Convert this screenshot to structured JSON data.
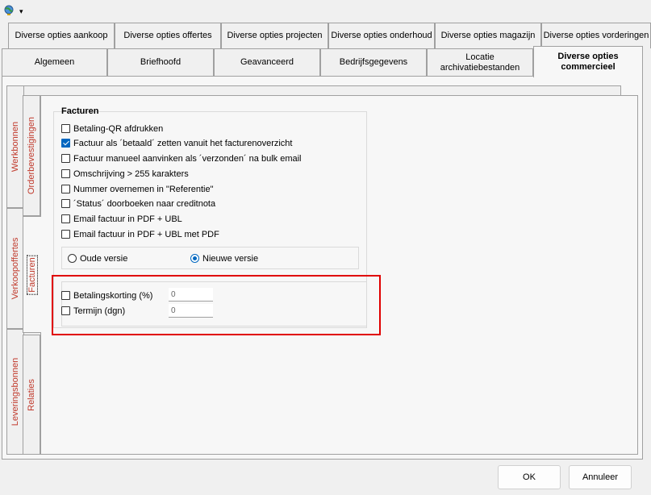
{
  "toolbar": {
    "icon": "globe-icon",
    "dropdown": "▾"
  },
  "top_tabs": [
    {
      "label": "Diverse opties aankoop"
    },
    {
      "label": "Diverse opties offertes"
    },
    {
      "label": "Diverse opties projecten"
    },
    {
      "label": "Diverse opties onderhoud"
    },
    {
      "label": "Diverse opties magazijn"
    },
    {
      "label": "Diverse opties vorderingen"
    }
  ],
  "second_tabs": [
    {
      "label": "Algemeen"
    },
    {
      "label": "Briefhoofd"
    },
    {
      "label": "Geavanceerd"
    },
    {
      "label": "Bedrijfsgegevens"
    },
    {
      "label": "Locatie archivatiebestanden"
    },
    {
      "label": "Diverse opties commercieel",
      "active": true
    }
  ],
  "outer_vtabs": [
    "Werkbonnen",
    "Verkoopoffertes",
    "Leveringsbonnen"
  ],
  "inner_vtabs": [
    "Orderbevestigingen",
    "Facturen",
    "Relaties"
  ],
  "group": {
    "title": "Facturen",
    "checkboxes": [
      {
        "label": "Betaling-QR afdrukken",
        "checked": false
      },
      {
        "label": "Factuur als ´betaald´ zetten vanuit het facturenoverzicht",
        "checked": true
      },
      {
        "label": "Factuur manueel aanvinken als ´verzonden´ na bulk email",
        "checked": false
      },
      {
        "label": "Omschrijving > 255 karakters",
        "checked": false
      },
      {
        "label": "Nummer overnemen in \"Referentie\"",
        "checked": false
      },
      {
        "label": "´Status´ doorboeken naar creditnota",
        "checked": false
      },
      {
        "label": "Email factuur in PDF + UBL",
        "checked": false
      },
      {
        "label": "Email factuur in PDF + UBL met PDF",
        "checked": false
      }
    ],
    "radios": [
      {
        "label": "Oude versie",
        "selected": false
      },
      {
        "label": "Nieuwe versie",
        "selected": true
      }
    ],
    "fields": [
      {
        "label": "Betalingskorting (%)",
        "value": "0"
      },
      {
        "label": "Termijn (dgn)",
        "value": "0"
      }
    ]
  },
  "buttons": {
    "ok": "OK",
    "cancel": "Annuleer"
  },
  "colors": {
    "accent": "#0067c0",
    "vtab_text": "#c0392b",
    "highlight": "#e00000"
  }
}
